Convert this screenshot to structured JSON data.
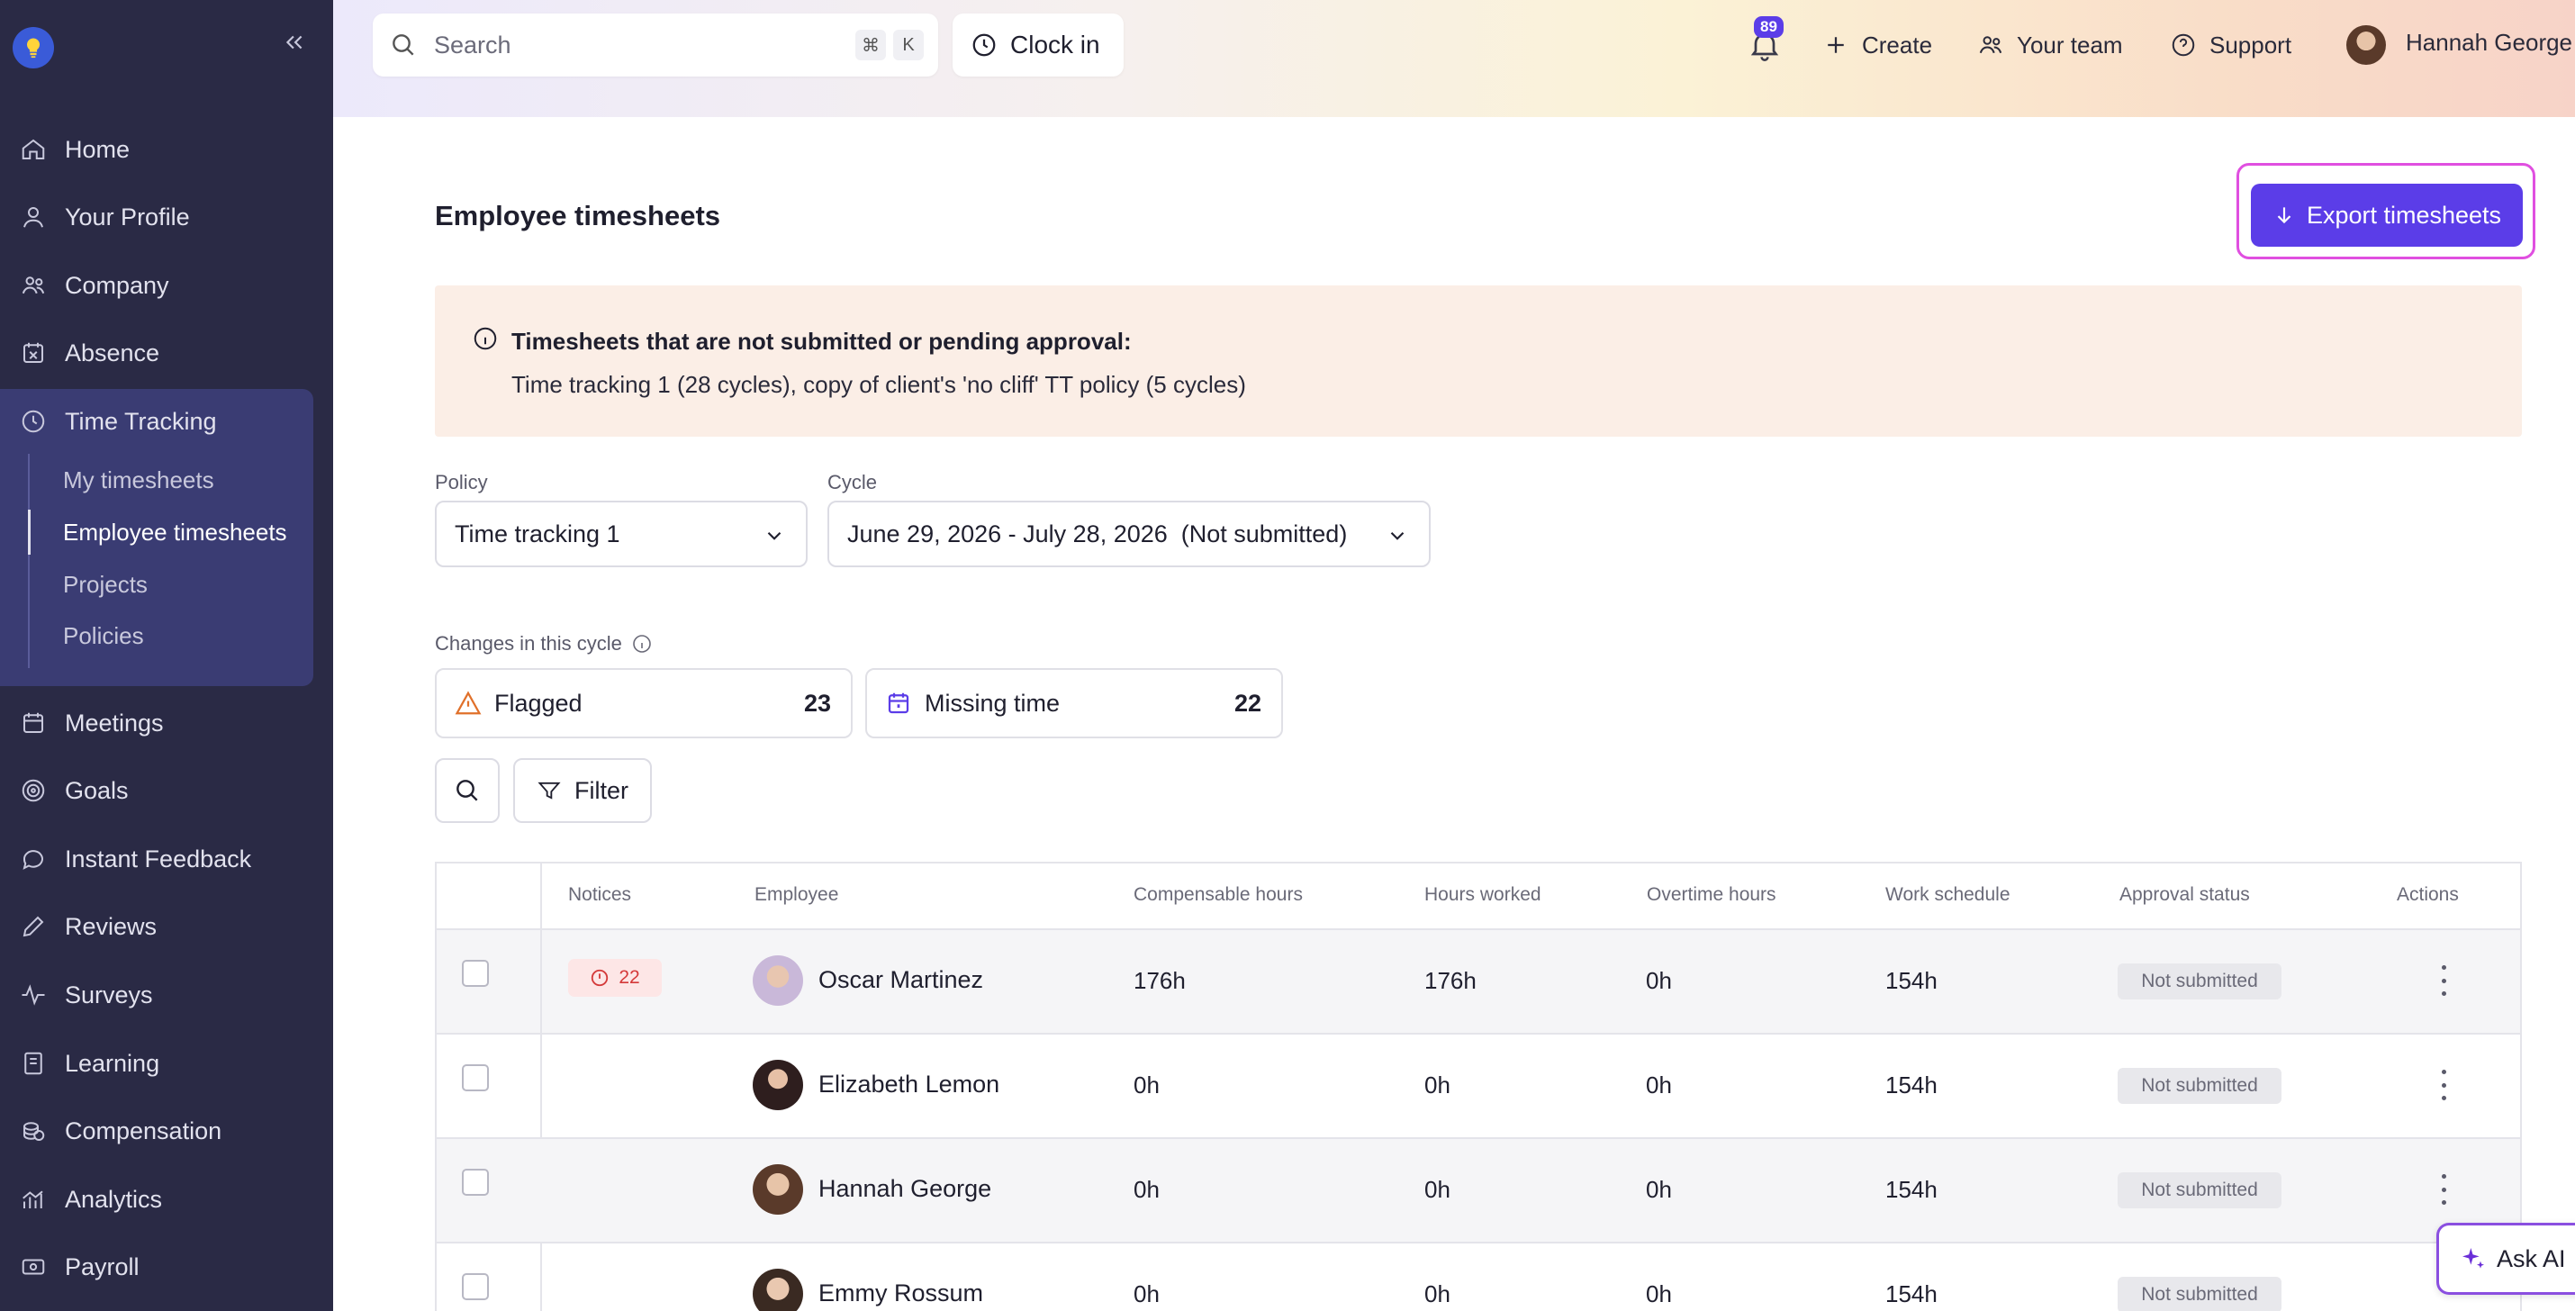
{
  "sidebar": {
    "nav": [
      {
        "label": "Home",
        "icon": "home-icon"
      },
      {
        "label": "Your Profile",
        "icon": "user-icon"
      },
      {
        "label": "Company",
        "icon": "company-icon"
      },
      {
        "label": "Absence",
        "icon": "calendar-x-icon"
      },
      {
        "label": "Time Tracking",
        "icon": "clock-icon"
      },
      {
        "label": "Meetings",
        "icon": "calendar-icon"
      },
      {
        "label": "Goals",
        "icon": "target-icon"
      },
      {
        "label": "Instant Feedback",
        "icon": "chat-icon"
      },
      {
        "label": "Reviews",
        "icon": "pencil-icon"
      },
      {
        "label": "Surveys",
        "icon": "pulse-icon"
      },
      {
        "label": "Learning",
        "icon": "book-icon"
      },
      {
        "label": "Compensation",
        "icon": "coins-icon"
      },
      {
        "label": "Analytics",
        "icon": "analytics-icon"
      },
      {
        "label": "Payroll",
        "icon": "money-icon"
      }
    ],
    "time_tracking_sub": [
      {
        "label": "My timesheets"
      },
      {
        "label": "Employee timesheets",
        "active": true
      },
      {
        "label": "Projects"
      },
      {
        "label": "Policies"
      }
    ]
  },
  "topbar": {
    "search_placeholder": "Search",
    "shortcut_cmd": "⌘",
    "shortcut_key": "K",
    "clock_in": "Clock in",
    "notification_count": "89",
    "create": "Create",
    "your_team": "Your team",
    "support": "Support",
    "user_name": "Hannah George"
  },
  "page": {
    "title": "Employee timesheets",
    "export_label": "Export timesheets",
    "notice_title": "Timesheets that are not submitted or pending approval:",
    "notice_body": "Time tracking 1 (28 cycles), copy of client's 'no cliff' TT policy (5 cycles)",
    "policy_label": "Policy",
    "policy_value": "Time tracking 1",
    "cycle_label": "Cycle",
    "cycle_value": "June 29, 2026 - July 28, 2026  (Not submitted)",
    "changes_label": "Changes in this cycle",
    "flagged_label": "Flagged",
    "flagged_count": "23",
    "missing_label": "Missing time",
    "missing_count": "22",
    "filter_label": "Filter"
  },
  "table": {
    "headers": [
      "Notices",
      "Employee",
      "Compensable hours",
      "Hours worked",
      "Overtime hours",
      "Work schedule",
      "Approval status",
      "Actions"
    ],
    "rows": [
      {
        "notice": "22",
        "name": "Oscar Martinez",
        "compensable": "176h",
        "worked": "176h",
        "overtime": "0h",
        "schedule": "154h",
        "status": "Not submitted"
      },
      {
        "notice": "",
        "name": "Elizabeth Lemon",
        "compensable": "0h",
        "worked": "0h",
        "overtime": "0h",
        "schedule": "154h",
        "status": "Not submitted"
      },
      {
        "notice": "",
        "name": "Hannah George",
        "compensable": "0h",
        "worked": "0h",
        "overtime": "0h",
        "schedule": "154h",
        "status": "Not submitted"
      },
      {
        "notice": "",
        "name": "Emmy Rossum",
        "compensable": "0h",
        "worked": "0h",
        "overtime": "0h",
        "schedule": "154h",
        "status": "Not submitted"
      }
    ]
  },
  "ask_ai": "Ask AI",
  "colors": {
    "sidebar_bg": "#2a2a45",
    "accent": "#5b3de8",
    "notice_bg": "#fbeee6",
    "highlight": "#e04fe0"
  }
}
